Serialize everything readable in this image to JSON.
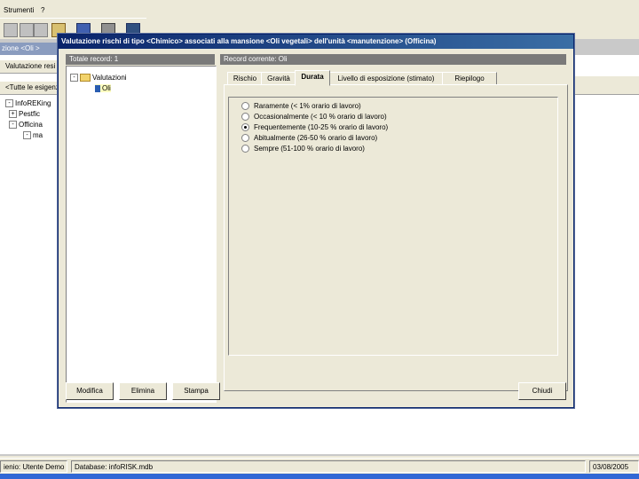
{
  "menubar": {
    "items": [
      "Strumenti",
      "?"
    ]
  },
  "background": {
    "window_title": "zione <Oli >",
    "tab_label": "Valutazione resi",
    "filter_label": "<Tutte le esigenze",
    "tree": [
      {
        "label": "InfoREKing"
      },
      {
        "label": "Pestfic"
      },
      {
        "label": "Officina"
      },
      {
        "label": "ma"
      }
    ]
  },
  "dialog": {
    "title": "Valutazione rischi di tipo <Chimico> associati alla mansione <Oli vegetali> dell'unità <manutenzione> (Officina)",
    "left_header": "Totale record: 1",
    "right_header": "Record corrente: Oli",
    "tree": {
      "root": "Valutazioni",
      "child": "Oli"
    },
    "tabs": [
      {
        "label": "Rischio"
      },
      {
        "label": "Gravità"
      },
      {
        "label": "Durata"
      },
      {
        "label": "Livello di esposizione (stimato)"
      },
      {
        "label": "Riepilogo"
      }
    ],
    "active_tab": "Durata",
    "options": [
      {
        "label": "Raramente (< 1% orario di lavoro)",
        "selected": false
      },
      {
        "label": "Occasionalmente (< 10 % orario di lavoro)",
        "selected": false
      },
      {
        "label": "Frequentemente (10-25 % orario di lavoro)",
        "selected": true
      },
      {
        "label": "Abitualmente (26-50 % orario di lavoro)",
        "selected": false
      },
      {
        "label": "Sempre (51-100 % orario di lavoro)",
        "selected": false
      }
    ],
    "buttons": {
      "modify": "Modifica",
      "delete": "Elimina",
      "print": "Stampa",
      "close": "Chiudi"
    }
  },
  "statusbar": {
    "user": "ienio: Utente Demo",
    "database": "Database: infoRISK.mdb",
    "date": "03/08/2005"
  },
  "colors": {
    "titlebar_start": "#0a246a",
    "titlebar_end": "#3a6ea5",
    "face": "#ece9d8"
  }
}
